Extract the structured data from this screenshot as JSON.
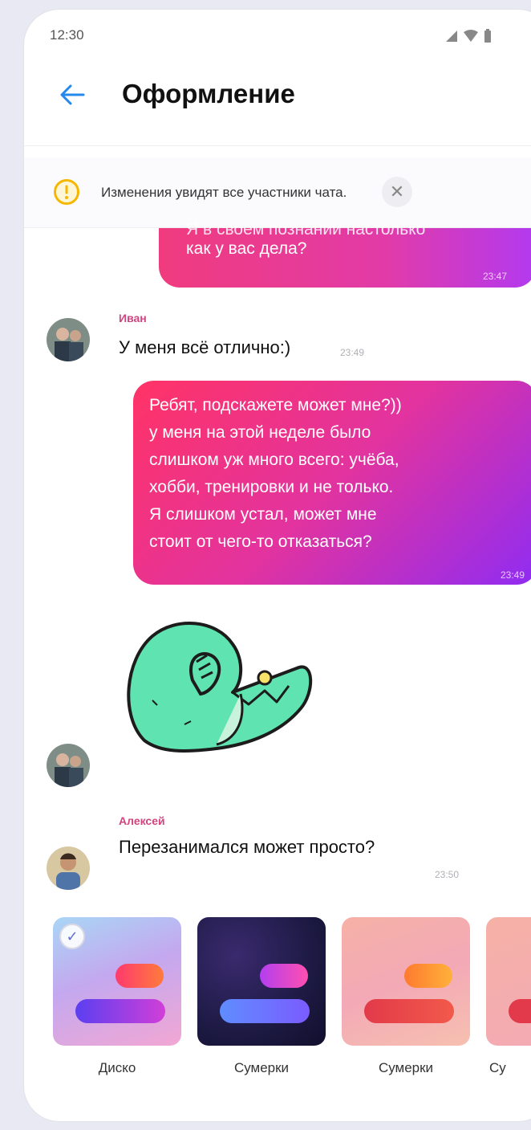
{
  "status": {
    "time": "12:30"
  },
  "header": {
    "title": "Оформление"
  },
  "notice": {
    "text": "Изменения увидят все участники чата.",
    "close_symbol": "✕"
  },
  "messages": {
    "top_bubble": {
      "cut_line": "Я в своем познании настолько",
      "text": "как у вас дела?",
      "time": "23:47"
    },
    "ivan": {
      "sender": "Иван",
      "text": "У меня всё отлично:)",
      "time": "23:49"
    },
    "outgoing": {
      "lines": [
        "Ребят, подскажете может мне?))",
        "у меня на этой неделе было",
        "слишком уж много всего: учёба,",
        "хобби, тренировки и не только.",
        "Я слишком устал, может мне",
        "стоит от чего-то отказаться?"
      ],
      "time": "23:49"
    },
    "aleksey": {
      "sender": "Алексей",
      "text": "Перезанимался может просто?",
      "time": "23:50"
    }
  },
  "themes": [
    {
      "label": "Диско",
      "selected": true
    },
    {
      "label": "Сумерки",
      "selected": false
    },
    {
      "label": "Сумерки",
      "selected": false
    },
    {
      "label": "Су",
      "selected": false
    }
  ],
  "icons": {
    "back": "arrow-left-icon",
    "notice": "warning-circle-icon",
    "close": "close-icon",
    "check": "checkmark-icon",
    "signal": "signal-icon",
    "wifi": "wifi-icon",
    "battery": "battery-icon"
  },
  "colors": {
    "accent": "#2688eb",
    "warning": "#f5b700",
    "bubble_start": "#ff3366",
    "bubble_end": "#8f2cf3",
    "sender": "#d0457f"
  }
}
